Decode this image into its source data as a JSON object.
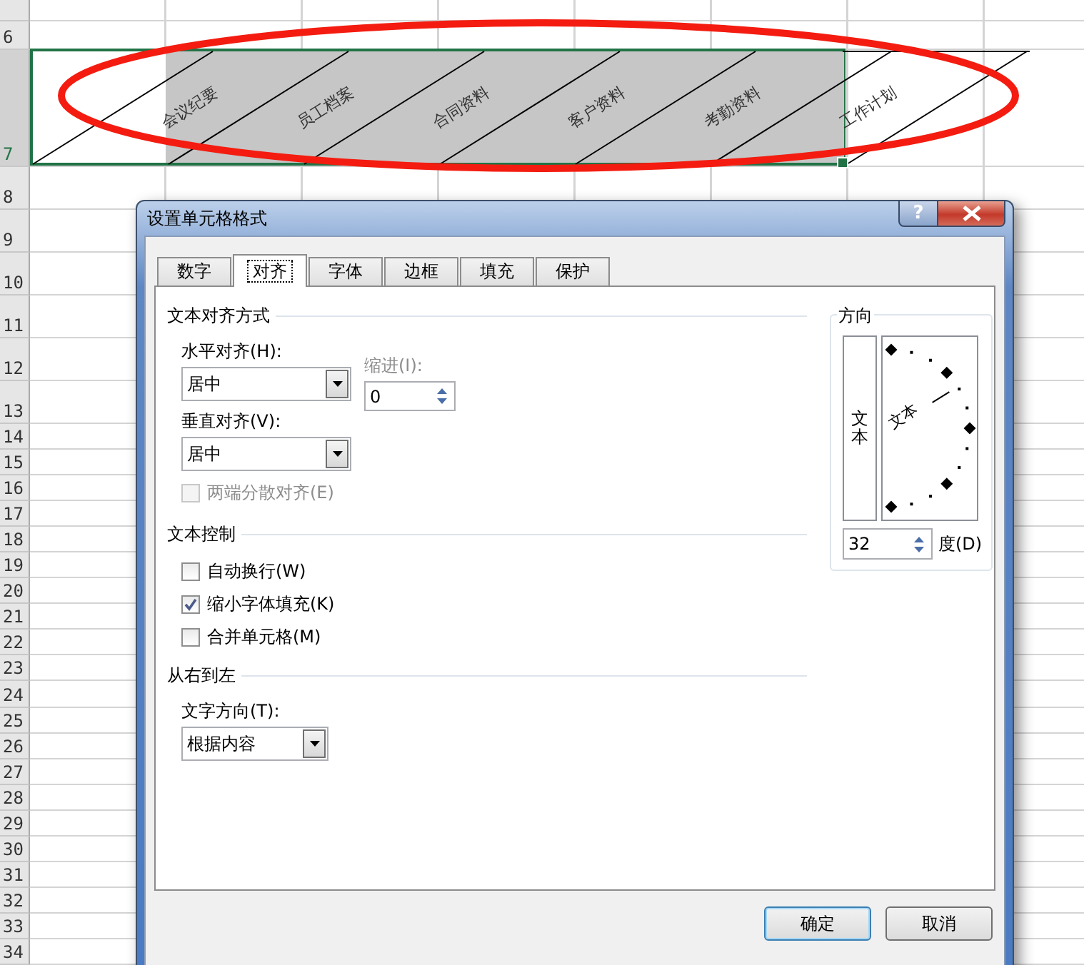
{
  "sheet": {
    "rows": [
      {
        "label": "6",
        "selected": false,
        "cells": []
      },
      {
        "label": "7",
        "selected": true,
        "cells": [
          {
            "text": "会议纪要",
            "active": true
          },
          {
            "text": "员工档案",
            "active": false
          },
          {
            "text": "合同资料",
            "active": false
          },
          {
            "text": "客户资料",
            "active": false
          },
          {
            "text": "考勤资料",
            "active": false
          },
          {
            "text": "工作计划",
            "active": false
          }
        ]
      },
      {
        "label": "8",
        "selected": false,
        "cells": []
      },
      {
        "label": "9",
        "selected": false,
        "cells": []
      },
      {
        "label": "10",
        "selected": false,
        "cells": []
      },
      {
        "label": "11",
        "selected": false,
        "cells": []
      },
      {
        "label": "12",
        "selected": false,
        "cells": []
      },
      {
        "label": "13",
        "selected": false,
        "cells": []
      },
      {
        "label": "14",
        "selected": false,
        "cells": []
      },
      {
        "label": "15",
        "selected": false,
        "cells": []
      },
      {
        "label": "16",
        "selected": false,
        "cells": []
      },
      {
        "label": "17",
        "selected": false,
        "cells": []
      },
      {
        "label": "18",
        "selected": false,
        "cells": []
      },
      {
        "label": "19",
        "selected": false,
        "cells": []
      },
      {
        "label": "20",
        "selected": false,
        "cells": []
      },
      {
        "label": "21",
        "selected": false,
        "cells": []
      },
      {
        "label": "22",
        "selected": false,
        "cells": []
      },
      {
        "label": "23",
        "selected": false,
        "cells": []
      },
      {
        "label": "24",
        "selected": false,
        "cells": []
      },
      {
        "label": "25",
        "selected": false,
        "cells": []
      },
      {
        "label": "26",
        "selected": false,
        "cells": []
      },
      {
        "label": "27",
        "selected": false,
        "cells": []
      },
      {
        "label": "28",
        "selected": false,
        "cells": []
      },
      {
        "label": "29",
        "selected": false,
        "cells": []
      },
      {
        "label": "30",
        "selected": false,
        "cells": []
      },
      {
        "label": "31",
        "selected": false,
        "cells": []
      },
      {
        "label": "32",
        "selected": false,
        "cells": []
      },
      {
        "label": "33",
        "selected": false,
        "cells": []
      },
      {
        "label": "34",
        "selected": false,
        "cells": []
      }
    ]
  },
  "dialog": {
    "title": "设置单元格格式",
    "help_button": "?",
    "tabs": [
      {
        "label": "数字",
        "selected": false
      },
      {
        "label": "对齐",
        "selected": true
      },
      {
        "label": "字体",
        "selected": false
      },
      {
        "label": "边框",
        "selected": false
      },
      {
        "label": "填充",
        "selected": false
      },
      {
        "label": "保护",
        "selected": false
      }
    ],
    "alignment": {
      "heading": "文本对齐方式",
      "horizontal": {
        "label": "水平对齐(H):",
        "value": "居中"
      },
      "indent": {
        "label": "缩进(I):",
        "value": "0",
        "disabled": true
      },
      "vertical": {
        "label": "垂直对齐(V):",
        "value": "居中"
      },
      "distributed": {
        "label": "两端分散对齐(E)",
        "checked": false,
        "disabled": true
      }
    },
    "text_control": {
      "heading": "文本控制",
      "options": [
        {
          "label": "自动换行(W)",
          "checked": false
        },
        {
          "label": "缩小字体填充(K)",
          "checked": true
        },
        {
          "label": "合并单元格(M)",
          "checked": false
        }
      ]
    },
    "rtl": {
      "heading": "从右到左",
      "direction": {
        "label": "文字方向(T):",
        "value": "根据内容"
      }
    },
    "orientation": {
      "heading": "方向",
      "vertical_text": "文本",
      "dial_text": "文本",
      "degrees": "32",
      "unit_label": "度(D)"
    },
    "buttons": [
      {
        "label": "确定",
        "default": true
      },
      {
        "label": "取消",
        "default": false
      }
    ]
  }
}
